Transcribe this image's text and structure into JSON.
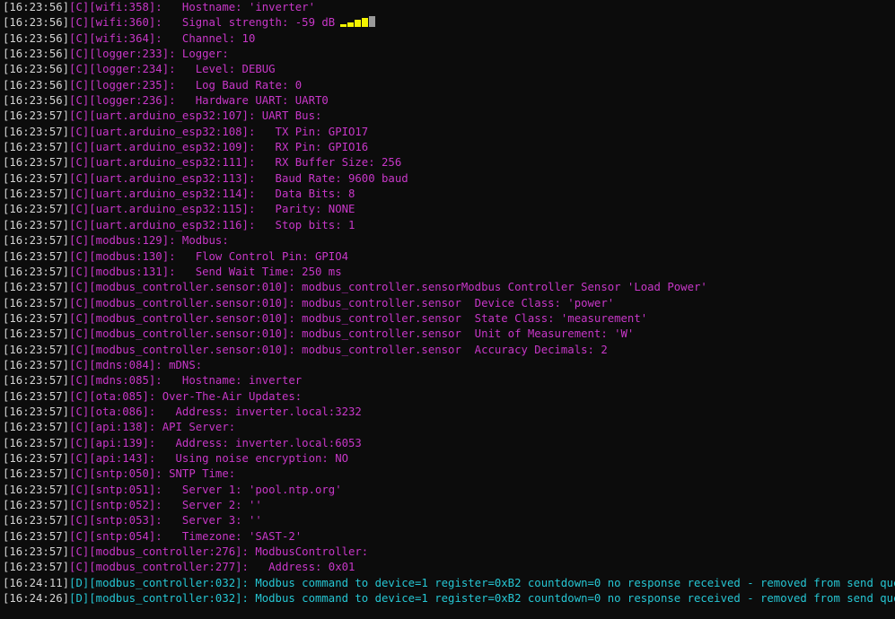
{
  "colors": {
    "background": "#0c0c0c",
    "timestamp": "#d4d4d4",
    "config_level": "#c837c8",
    "debug_level": "#26c6d3",
    "signal_on": "#f4f400",
    "signal_off": "#9a9a9a"
  },
  "signal_icon": {
    "name": "signal-strength-icon",
    "bars_total": 4,
    "bars_active": 3
  },
  "lines": [
    {
      "ts": "[16:23:56]",
      "lvl": "[C]",
      "msg": "[wifi:358]:   Hostname: 'inverter'"
    },
    {
      "ts": "[16:23:56]",
      "lvl": "[C]",
      "msg": "[wifi:360]:   Signal strength: -59 dB"
    },
    {
      "ts": "[16:23:56]",
      "lvl": "[C]",
      "msg": "[wifi:364]:   Channel: 10"
    },
    {
      "ts": "[16:23:56]",
      "lvl": "[C]",
      "msg": "[logger:233]: Logger:"
    },
    {
      "ts": "[16:23:56]",
      "lvl": "[C]",
      "msg": "[logger:234]:   Level: DEBUG"
    },
    {
      "ts": "[16:23:56]",
      "lvl": "[C]",
      "msg": "[logger:235]:   Log Baud Rate: 0"
    },
    {
      "ts": "[16:23:56]",
      "lvl": "[C]",
      "msg": "[logger:236]:   Hardware UART: UART0"
    },
    {
      "ts": "[16:23:57]",
      "lvl": "[C]",
      "msg": "[uart.arduino_esp32:107]: UART Bus:"
    },
    {
      "ts": "[16:23:57]",
      "lvl": "[C]",
      "msg": "[uart.arduino_esp32:108]:   TX Pin: GPIO17"
    },
    {
      "ts": "[16:23:57]",
      "lvl": "[C]",
      "msg": "[uart.arduino_esp32:109]:   RX Pin: GPIO16"
    },
    {
      "ts": "[16:23:57]",
      "lvl": "[C]",
      "msg": "[uart.arduino_esp32:111]:   RX Buffer Size: 256"
    },
    {
      "ts": "[16:23:57]",
      "lvl": "[C]",
      "msg": "[uart.arduino_esp32:113]:   Baud Rate: 9600 baud"
    },
    {
      "ts": "[16:23:57]",
      "lvl": "[C]",
      "msg": "[uart.arduino_esp32:114]:   Data Bits: 8"
    },
    {
      "ts": "[16:23:57]",
      "lvl": "[C]",
      "msg": "[uart.arduino_esp32:115]:   Parity: NONE"
    },
    {
      "ts": "[16:23:57]",
      "lvl": "[C]",
      "msg": "[uart.arduino_esp32:116]:   Stop bits: 1"
    },
    {
      "ts": "[16:23:57]",
      "lvl": "[C]",
      "msg": "[modbus:129]: Modbus:"
    },
    {
      "ts": "[16:23:57]",
      "lvl": "[C]",
      "msg": "[modbus:130]:   Flow Control Pin: GPIO4"
    },
    {
      "ts": "[16:23:57]",
      "lvl": "[C]",
      "msg": "[modbus:131]:   Send Wait Time: 250 ms"
    },
    {
      "ts": "[16:23:57]",
      "lvl": "[C]",
      "msg": "[modbus_controller.sensor:010]: modbus_controller.sensorModbus Controller Sensor 'Load Power'"
    },
    {
      "ts": "[16:23:57]",
      "lvl": "[C]",
      "msg": "[modbus_controller.sensor:010]: modbus_controller.sensor  Device Class: 'power'"
    },
    {
      "ts": "[16:23:57]",
      "lvl": "[C]",
      "msg": "[modbus_controller.sensor:010]: modbus_controller.sensor  State Class: 'measurement'"
    },
    {
      "ts": "[16:23:57]",
      "lvl": "[C]",
      "msg": "[modbus_controller.sensor:010]: modbus_controller.sensor  Unit of Measurement: 'W'"
    },
    {
      "ts": "[16:23:57]",
      "lvl": "[C]",
      "msg": "[modbus_controller.sensor:010]: modbus_controller.sensor  Accuracy Decimals: 2"
    },
    {
      "ts": "[16:23:57]",
      "lvl": "[C]",
      "msg": "[mdns:084]: mDNS:"
    },
    {
      "ts": "[16:23:57]",
      "lvl": "[C]",
      "msg": "[mdns:085]:   Hostname: inverter"
    },
    {
      "ts": "[16:23:57]",
      "lvl": "[C]",
      "msg": "[ota:085]: Over-The-Air Updates:"
    },
    {
      "ts": "[16:23:57]",
      "lvl": "[C]",
      "msg": "[ota:086]:   Address: inverter.local:3232"
    },
    {
      "ts": "[16:23:57]",
      "lvl": "[C]",
      "msg": "[api:138]: API Server:"
    },
    {
      "ts": "[16:23:57]",
      "lvl": "[C]",
      "msg": "[api:139]:   Address: inverter.local:6053"
    },
    {
      "ts": "[16:23:57]",
      "lvl": "[C]",
      "msg": "[api:143]:   Using noise encryption: NO"
    },
    {
      "ts": "[16:23:57]",
      "lvl": "[C]",
      "msg": "[sntp:050]: SNTP Time:"
    },
    {
      "ts": "[16:23:57]",
      "lvl": "[C]",
      "msg": "[sntp:051]:   Server 1: 'pool.ntp.org'"
    },
    {
      "ts": "[16:23:57]",
      "lvl": "[C]",
      "msg": "[sntp:052]:   Server 2: ''"
    },
    {
      "ts": "[16:23:57]",
      "lvl": "[C]",
      "msg": "[sntp:053]:   Server 3: ''"
    },
    {
      "ts": "[16:23:57]",
      "lvl": "[C]",
      "msg": "[sntp:054]:   Timezone: 'SAST-2'"
    },
    {
      "ts": "[16:23:57]",
      "lvl": "[C]",
      "msg": "[modbus_controller:276]: ModbusController:"
    },
    {
      "ts": "[16:23:57]",
      "lvl": "[C]",
      "msg": "[modbus_controller:277]:   Address: 0x01"
    },
    {
      "ts": "[16:24:11]",
      "lvl": "[D]",
      "msg": "[modbus_controller:032]: Modbus command to device=1 register=0xB2 countdown=0 no response received - removed from send queue"
    },
    {
      "ts": "[16:24:26]",
      "lvl": "[D]",
      "msg": "[modbus_controller:032]: Modbus command to device=1 register=0xB2 countdown=0 no response received - removed from send queue"
    }
  ]
}
